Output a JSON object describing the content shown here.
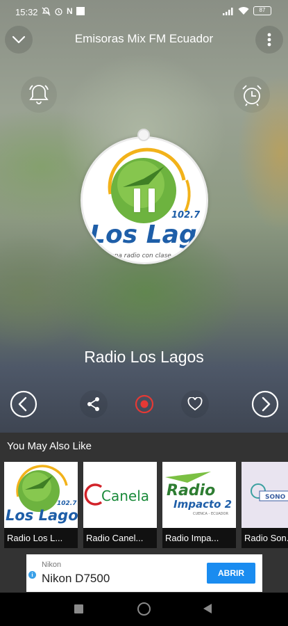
{
  "status_bar": {
    "time": "15:32",
    "notif_letter": "N",
    "battery": "87"
  },
  "header": {
    "title": "Emisoras Mix FM Ecuador",
    "back_icon": "chevron-down-icon",
    "menu_icon": "more-vertical-icon"
  },
  "player": {
    "alarm_icon": "bell-icon",
    "sleep_icon": "alarm-clock-icon",
    "station_name": "Radio Los Lagos",
    "logo": {
      "frequency": "102.7",
      "word": "Los Lagos",
      "tagline": "una radio con clase"
    },
    "state_icon": "pause-icon"
  },
  "controls": {
    "prev_icon": "chevron-left-icon",
    "share_icon": "share-icon",
    "record_icon": "record-icon",
    "favorite_icon": "heart-icon",
    "next_icon": "chevron-right-icon"
  },
  "recommendations": {
    "title": "You May Also Like",
    "items": [
      {
        "label": "Radio Los L...",
        "logo_text": "Los Lagos",
        "logo_sub": "102.7"
      },
      {
        "label": "Radio Canel...",
        "logo_text": "Canela"
      },
      {
        "label": "Radio Impa...",
        "logo_text": "Radio",
        "logo_sub": "Impacto 2"
      },
      {
        "label": "Radio Son...",
        "logo_text": "SONO"
      }
    ]
  },
  "ad": {
    "brand": "Nikon",
    "product": "Nikon D7500",
    "cta": "ABRIR"
  },
  "colors": {
    "accent_record": "#e53935",
    "ad_button": "#1a8cf0",
    "bottom_bg": "#333333"
  }
}
